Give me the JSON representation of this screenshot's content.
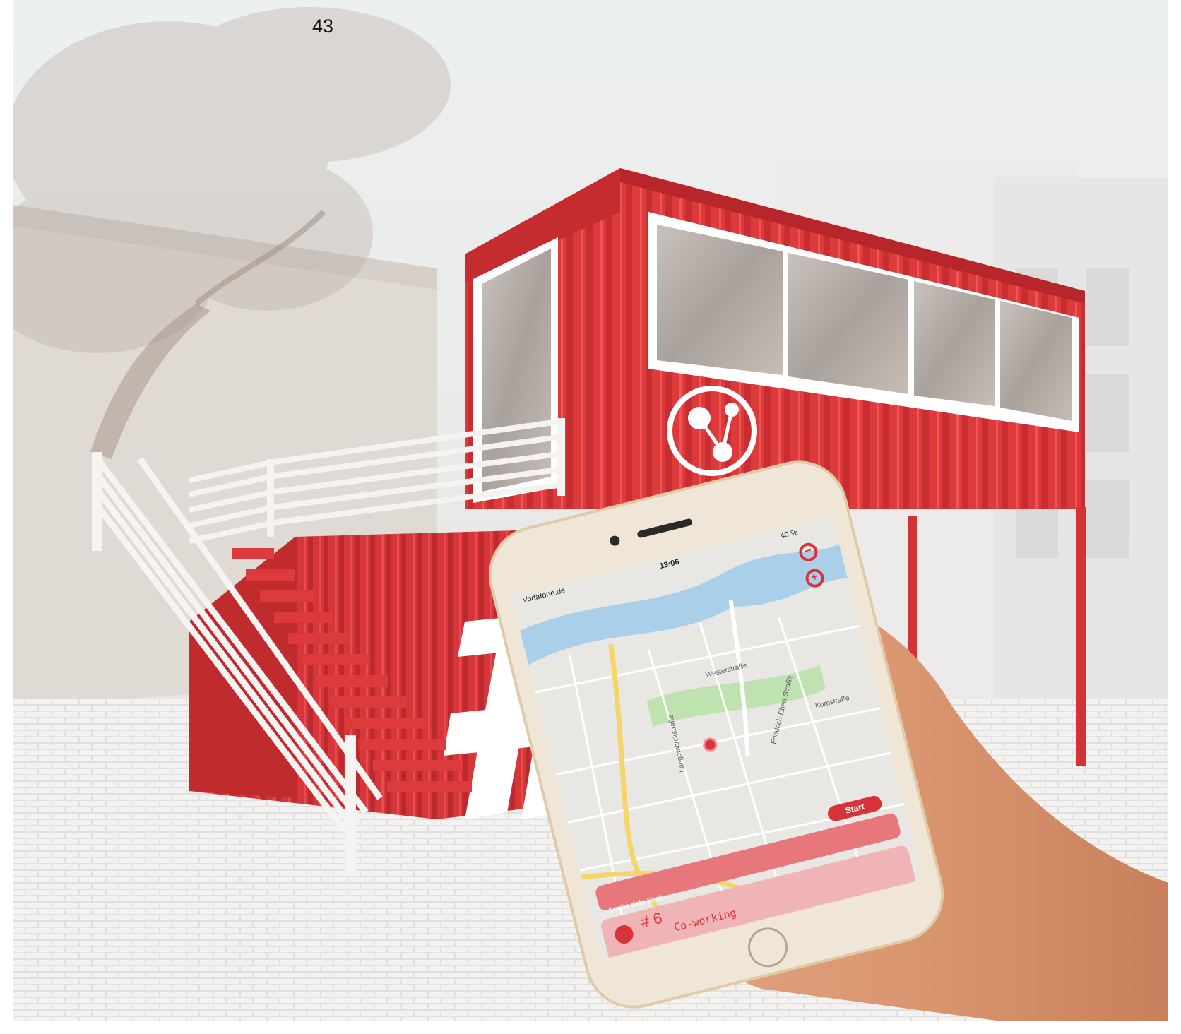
{
  "page": {
    "number": "43"
  },
  "colors": {
    "container_red": "#dd3b3b",
    "app_red": "#d9333a",
    "cobblestone": "#f2f1f0",
    "phone_gold": "#e9d8c0"
  },
  "phone": {
    "status_bar": {
      "carrier": "Vodafone.de",
      "time": "13:06",
      "battery": "40 %"
    },
    "map": {
      "street_labels": [
        "Westerstraße",
        "Langemarckstraße",
        "Friedrich-Ebert-Straße",
        "Kornstraße"
      ],
      "zoom_out_icon": "zoom-out-icon",
      "zoom_in_icon": "zoom-in-icon",
      "location_pin_icon": "location-pin-icon"
    },
    "start_button": {
      "label": "Start"
    },
    "search": {
      "placeholder": "Suche dein Spot ..."
    },
    "spot": {
      "number": "# 6",
      "name": "Co-working",
      "icon": "network-logo-icon"
    }
  }
}
